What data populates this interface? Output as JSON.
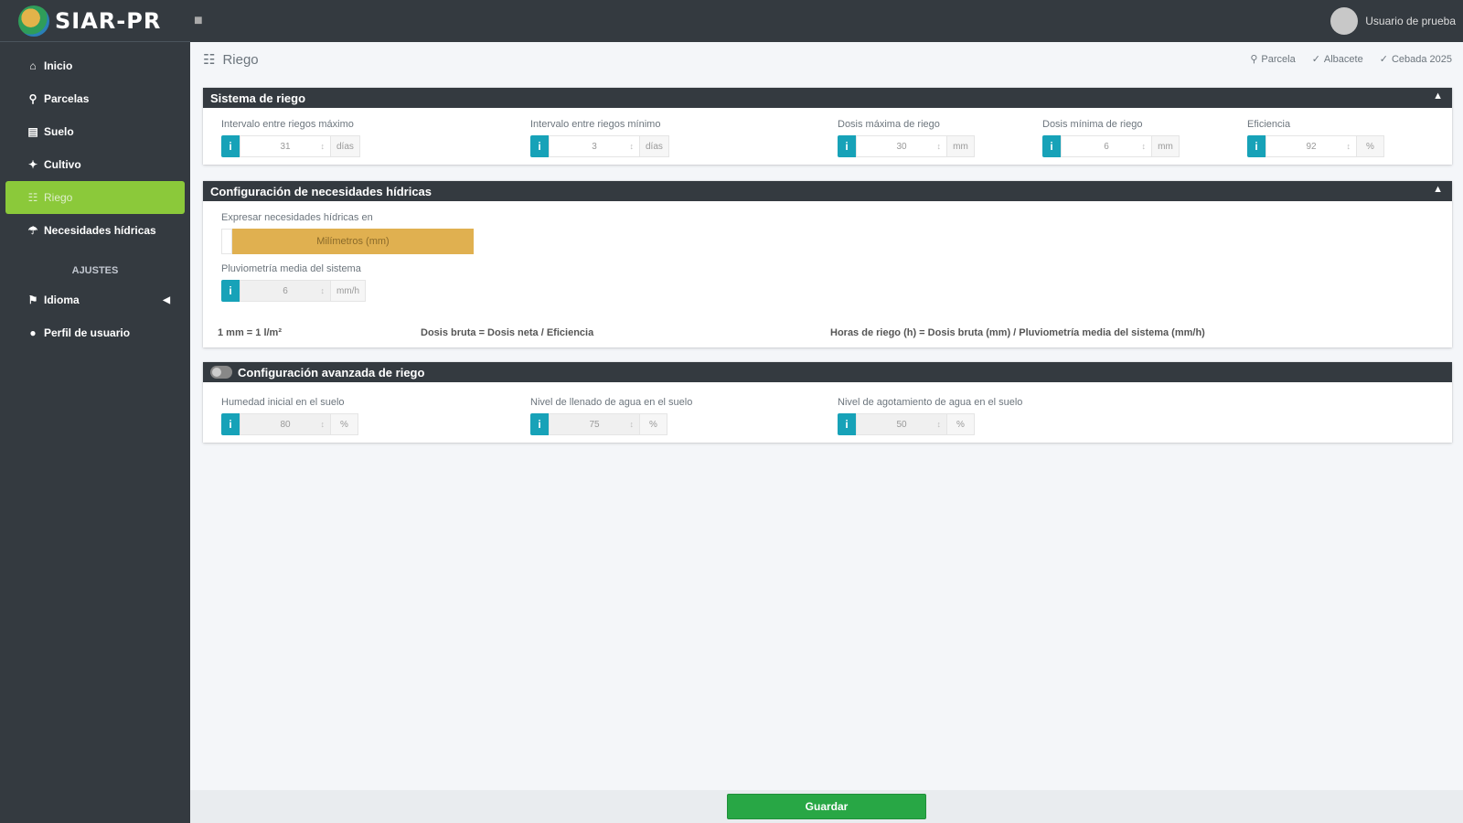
{
  "app": {
    "brand": "SIAR-PR",
    "user_name": "Usuario de prueba"
  },
  "sidebar": {
    "items": [
      {
        "label": "Inicio",
        "icon": "home-icon"
      },
      {
        "label": "Parcelas",
        "icon": "map-marker-icon"
      },
      {
        "label": "Suelo",
        "icon": "layers-icon"
      },
      {
        "label": "Cultivo",
        "icon": "seedling-icon"
      },
      {
        "label": "Riego",
        "icon": "irrigation-icon",
        "active": true
      },
      {
        "label": "Necesidades hídricas",
        "icon": "water-needs-icon"
      }
    ],
    "section_header": "AJUSTES",
    "settings": [
      {
        "label": "Idioma",
        "icon": "flag-icon"
      },
      {
        "label": "Perfil de usuario",
        "icon": "user-icon"
      }
    ]
  },
  "page": {
    "title": "Riego"
  },
  "breadcrumb": {
    "parcela": "Parcela",
    "location": "Albacete",
    "crop": "Cebada 2025"
  },
  "sistema": {
    "title": "Sistema de riego",
    "fields": [
      {
        "label": "Intervalo entre riegos máximo",
        "value": "31",
        "unit": "días"
      },
      {
        "label": "Intervalo entre riegos mínimo",
        "value": "3",
        "unit": "días"
      },
      {
        "label": "Dosis máxima de riego",
        "value": "30",
        "unit": "mm"
      },
      {
        "label": "Dosis mínima de riego",
        "value": "6",
        "unit": "mm"
      },
      {
        "label": "Eficiencia",
        "value": "92",
        "unit": "%"
      }
    ]
  },
  "necesidades": {
    "title": "Configuración de necesidades hídricas",
    "express_label": "Expresar necesidades hídricas en",
    "express_value": "Milímetros (mm)",
    "pluvio_label": "Pluviometría media del sistema",
    "pluvio_value": "6",
    "pluvio_unit": "mm/h",
    "formula1": "1 mm = 1 l/m²",
    "formula2": "Dosis bruta = Dosis neta / Eficiencia",
    "formula3": "Horas de riego (h) = Dosis bruta (mm) / Pluviometría media del sistema (mm/h)"
  },
  "avanzada": {
    "title": "Configuración avanzada de riego",
    "fields": [
      {
        "label": "Humedad inicial en el suelo",
        "value": "80",
        "unit": "%"
      },
      {
        "label": "Nivel de llenado de agua en el suelo",
        "value": "75",
        "unit": "%"
      },
      {
        "label": "Nivel de agotamiento de agua en el suelo",
        "value": "50",
        "unit": "%"
      }
    ]
  },
  "footer": {
    "save_label": "Guardar"
  }
}
